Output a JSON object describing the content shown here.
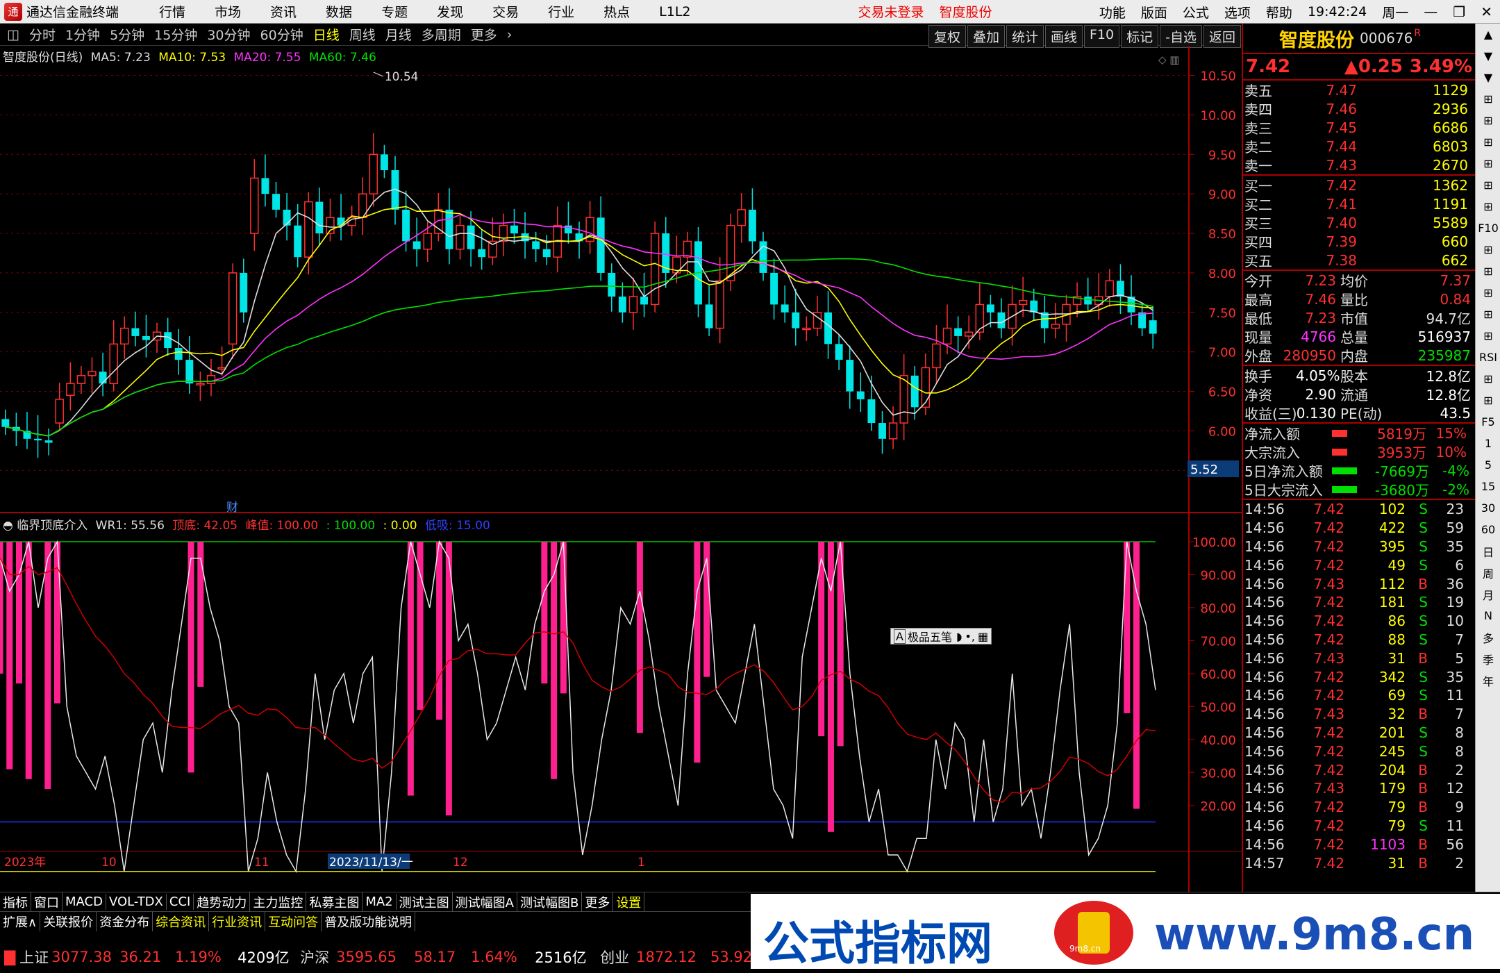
{
  "menubar": {
    "app": "通达信金融终端",
    "items": [
      "行情",
      "市场",
      "资讯",
      "数据",
      "专题",
      "发现",
      "交易",
      "行业",
      "热点",
      "L1L2"
    ],
    "warn1": "交易未登录",
    "warn2": "智度股份",
    "right": [
      "功能",
      "版面",
      "公式",
      "选项",
      "帮助"
    ],
    "clock": "19:42:24",
    "weekday": "周一"
  },
  "tfbar": {
    "items": [
      "分时",
      "1分钟",
      "5分钟",
      "15分钟",
      "30分钟",
      "60分钟",
      "日线",
      "周线",
      "月线",
      "多周期",
      "更多"
    ],
    "selected": "日线",
    "right": [
      "复权",
      "叠加",
      "统计",
      "画线",
      "F10",
      "标记",
      "-自选",
      "返回"
    ]
  },
  "legend1": {
    "title": "智度股份(日线)",
    "ma5": "MA5: 7.23",
    "ma10": "MA10: 7.53",
    "ma20": "MA20: 7.55",
    "ma60": "MA60: 7.46"
  },
  "legend2": {
    "title": "临界顶底介入",
    "wr1": "WR1: 55.56",
    "dd": "顶底: 42.05",
    "fz": "峰值: 100.00",
    "v1": ": 100.00",
    "v2": ": 0.00",
    "v3": "低吸: 15.00"
  },
  "price_axis": [
    "10.50",
    "10.00",
    "9.50",
    "9.00",
    "8.50",
    "8.00",
    "7.50",
    "7.00",
    "6.50",
    "6.00",
    "5.50"
  ],
  "price_cursor": "5.52",
  "high_label": "10.54",
  "cai": "财",
  "ind_axis": [
    "100.00",
    "90.00",
    "80.00",
    "70.00",
    "60.00",
    "50.00",
    "40.00",
    "30.00",
    "20.00"
  ],
  "date_axis": {
    "y": "2023年",
    "m10": "10",
    "m11": "11",
    "cur": "2023/11/13/一",
    "m12": "12",
    "m1": "1"
  },
  "float_tool": {
    "label": "极品五笔"
  },
  "chart_data": [
    {
      "type": "candlestick",
      "title": "智度股份(日线)",
      "ylim": [
        5.5,
        10.54
      ],
      "ma": {
        "MA5": 7.23,
        "MA10": 7.53,
        "MA20": 7.55,
        "MA60": 7.46
      },
      "close": [
        6.05,
        6.0,
        5.9,
        5.88,
        5.85,
        6.4,
        6.6,
        6.7,
        6.75,
        6.6,
        7.1,
        7.3,
        7.2,
        7.15,
        7.25,
        7.05,
        6.9,
        6.6,
        6.6,
        6.7,
        6.8,
        8.0,
        7.5,
        9.2,
        9.0,
        8.8,
        8.6,
        8.2,
        8.9,
        8.5,
        8.7,
        8.6,
        8.7,
        9.0,
        9.5,
        9.3,
        8.8,
        8.4,
        8.3,
        8.5,
        8.8,
        8.3,
        8.6,
        8.3,
        8.2,
        8.4,
        8.6,
        8.5,
        8.4,
        8.3,
        8.2,
        8.6,
        8.5,
        8.4,
        8.7,
        8.0,
        7.7,
        7.5,
        7.7,
        7.6,
        8.5,
        8.0,
        8.2,
        8.4,
        7.6,
        7.3,
        7.9,
        8.6,
        8.8,
        8.4,
        8.0,
        7.6,
        7.5,
        7.3,
        7.3,
        7.5,
        7.1,
        6.9,
        6.5,
        6.4,
        6.1,
        5.9,
        6.1,
        6.7,
        6.3,
        6.8,
        7.1,
        7.3,
        7.2,
        7.25,
        7.6,
        7.5,
        7.3,
        7.6,
        7.65,
        7.5,
        7.3,
        7.35,
        7.6,
        7.7,
        7.6,
        7.7,
        7.9,
        7.7,
        7.5,
        7.3,
        7.23
      ],
      "open": [
        6.15,
        6.05,
        6.0,
        5.9,
        5.88,
        6.1,
        6.45,
        6.6,
        6.7,
        6.75,
        6.6,
        7.1,
        7.3,
        7.2,
        7.15,
        7.25,
        7.05,
        6.9,
        6.6,
        6.6,
        6.8,
        7.1,
        8.0,
        8.5,
        9.2,
        9.0,
        8.8,
        8.6,
        8.2,
        8.9,
        8.5,
        8.7,
        8.6,
        8.7,
        9.0,
        9.5,
        9.3,
        8.8,
        8.4,
        8.3,
        8.5,
        8.8,
        8.3,
        8.6,
        8.3,
        8.2,
        8.4,
        8.6,
        8.5,
        8.4,
        8.3,
        8.2,
        8.6,
        8.5,
        8.4,
        8.7,
        8.0,
        7.7,
        7.5,
        7.7,
        7.6,
        8.5,
        8.0,
        8.2,
        8.4,
        7.6,
        7.3,
        7.9,
        8.6,
        8.8,
        8.4,
        8.0,
        7.6,
        7.5,
        7.3,
        7.3,
        7.5,
        7.1,
        6.9,
        6.5,
        6.4,
        6.1,
        5.9,
        6.1,
        6.7,
        6.3,
        6.8,
        7.1,
        7.3,
        7.2,
        7.25,
        7.6,
        7.5,
        7.3,
        7.6,
        7.65,
        7.5,
        7.3,
        7.35,
        7.6,
        7.7,
        7.6,
        7.7,
        7.9,
        7.7,
        7.5,
        7.4
      ]
    },
    {
      "type": "line",
      "title": "临界顶底介入",
      "ylim": [
        0,
        100
      ],
      "levels": {
        "峰值": 100,
        "低吸": 15
      },
      "WR1": 55.56,
      "顶底": 42.05,
      "wr": [
        95,
        85,
        90,
        100,
        80,
        95,
        100,
        50,
        35,
        30,
        25,
        35,
        20,
        0,
        20,
        40,
        45,
        30,
        55,
        75,
        95,
        95,
        80,
        70,
        50,
        45,
        0,
        10,
        30,
        15,
        5,
        0,
        25,
        60,
        40,
        55,
        60,
        45,
        60,
        65,
        0,
        30,
        80,
        100,
        90,
        80,
        100,
        95,
        70,
        75,
        60,
        40,
        45,
        55,
        65,
        55,
        75,
        85,
        90,
        100,
        30,
        5,
        20,
        40,
        55,
        80,
        75,
        85,
        70,
        50,
        35,
        20,
        60,
        85,
        95,
        55,
        50,
        45,
        60,
        75,
        50,
        25,
        20,
        10,
        65,
        80,
        95,
        85,
        100,
        60,
        35,
        15,
        25,
        5,
        5,
        0,
        10,
        10,
        40,
        25,
        45,
        40,
        15,
        40,
        15,
        25,
        60,
        20,
        25,
        10,
        30,
        55,
        75,
        30,
        5,
        10,
        20,
        45,
        100,
        85,
        75,
        55
      ]
    }
  ],
  "right": {
    "name": "智度股份",
    "code": "000676",
    "r": "R",
    "price": "7.42",
    "chg": "▲0.25",
    "pct": "3.49%",
    "sell": [
      [
        "卖五",
        "7.47",
        "1129"
      ],
      [
        "卖四",
        "7.46",
        "2936"
      ],
      [
        "卖三",
        "7.45",
        "6686"
      ],
      [
        "卖二",
        "7.44",
        "6803"
      ],
      [
        "卖一",
        "7.43",
        "2670"
      ]
    ],
    "buy": [
      [
        "买一",
        "7.42",
        "1362"
      ],
      [
        "买二",
        "7.41",
        "1191"
      ],
      [
        "买三",
        "7.40",
        "5589"
      ],
      [
        "买四",
        "7.39",
        "660"
      ],
      [
        "买五",
        "7.38",
        "662"
      ]
    ],
    "stats": [
      [
        "今开",
        "7.23",
        "均价",
        "7.37"
      ],
      [
        "最高",
        "7.46",
        "量比",
        "0.84"
      ],
      [
        "最低",
        "7.23",
        "市值",
        "94.7亿"
      ],
      [
        "现量",
        "4766",
        "总量",
        "516937"
      ],
      [
        "外盘",
        "280950",
        "内盘",
        "235987"
      ]
    ],
    "fin": [
      [
        "换手",
        "4.05%",
        "股本",
        "12.8亿"
      ],
      [
        "净资",
        "2.90",
        "流通",
        "12.8亿"
      ],
      [
        "收益(三)",
        "0.130",
        "PE(动)",
        "43.5"
      ]
    ],
    "flow": [
      [
        "净流入额",
        "5819万",
        "15%"
      ],
      [
        "大宗流入",
        "3953万",
        "10%"
      ],
      [
        "5日净流入额",
        "-7669万",
        "-4%"
      ],
      [
        "5日大宗流入",
        "-3680万",
        "-2%"
      ]
    ],
    "ticks": [
      [
        "14:56",
        "7.42",
        "102",
        "S",
        "23"
      ],
      [
        "14:56",
        "7.42",
        "422",
        "S",
        "59"
      ],
      [
        "14:56",
        "7.42",
        "395",
        "S",
        "35"
      ],
      [
        "14:56",
        "7.42",
        "49",
        "S",
        "6"
      ],
      [
        "14:56",
        "7.43",
        "112",
        "B",
        "36"
      ],
      [
        "14:56",
        "7.42",
        "181",
        "S",
        "19"
      ],
      [
        "14:56",
        "7.42",
        "86",
        "S",
        "10"
      ],
      [
        "14:56",
        "7.42",
        "88",
        "S",
        "7"
      ],
      [
        "14:56",
        "7.43",
        "31",
        "B",
        "5"
      ],
      [
        "14:56",
        "7.42",
        "342",
        "S",
        "35"
      ],
      [
        "14:56",
        "7.42",
        "69",
        "S",
        "11"
      ],
      [
        "14:56",
        "7.43",
        "32",
        "B",
        "7"
      ],
      [
        "14:56",
        "7.42",
        "201",
        "S",
        "8"
      ],
      [
        "14:56",
        "7.42",
        "245",
        "S",
        "8"
      ],
      [
        "14:56",
        "7.42",
        "204",
        "B",
        "2"
      ],
      [
        "14:56",
        "7.43",
        "179",
        "B",
        "12"
      ],
      [
        "14:56",
        "7.42",
        "79",
        "B",
        "9"
      ],
      [
        "14:56",
        "7.42",
        "79",
        "S",
        "11"
      ],
      [
        "14:56",
        "7.42",
        "1103",
        "B",
        "56"
      ],
      [
        "14:57",
        "7.42",
        "31",
        "B",
        "2"
      ]
    ]
  },
  "rtools": [
    "▲",
    "▼",
    "▼",
    "⊞",
    "⊞",
    "⊞",
    "⊞",
    "⊞",
    "⊞",
    "F10",
    "⊞",
    "⊞",
    "⊞",
    "⊞",
    "⊞",
    "RSI",
    "⊞",
    "⊞",
    "F5",
    "1",
    "5",
    "15",
    "30",
    "60",
    "日",
    "周",
    "月",
    "N",
    "多",
    "季",
    "年"
  ],
  "bottom": {
    "tabs1": [
      "指标",
      "窗口",
      "MACD",
      "VOL-TDX",
      "CCI",
      "趋势动力",
      "主力监控",
      "私募主图",
      "MA2",
      "测试主图",
      "测试幅图A",
      "测试幅图B",
      "更多",
      "设置"
    ],
    "tabs2": [
      "扩展∧",
      "关联报价",
      "资金分布",
      "综合资讯",
      "行业资讯",
      "互动问答",
      "普及版功能说明"
    ],
    "idx": [
      {
        "n": "上证",
        "v": "3077.38",
        "c": "36.21",
        "p": "1.19%",
        "a": "4209亿"
      },
      {
        "n": "沪深",
        "v": "3595.65",
        "c": "58.17",
        "p": "1.64%",
        "a": "2516亿"
      },
      {
        "n": "创业",
        "v": "1872.12",
        "c": "53.92"
      }
    ]
  },
  "watermark": {
    "t1": "公式指标网",
    "t2": "www.9m8.cn",
    "seal": "9m8.cn"
  }
}
